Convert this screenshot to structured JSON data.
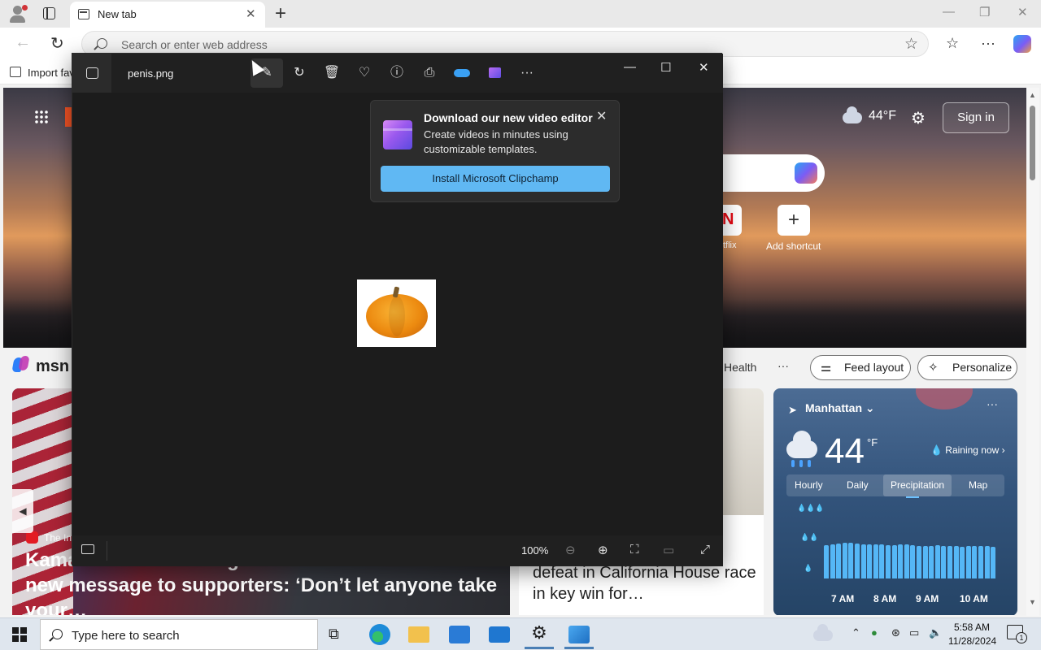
{
  "browser": {
    "tab_title": "New tab",
    "address_placeholder": "Search or enter web address",
    "favorites_import": "Import fav"
  },
  "msn": {
    "weather_temp": "44°F",
    "signin": "Sign in",
    "shortcuts": {
      "netflix_label": "tflix",
      "add_shortcut": "Add shortcut"
    },
    "logo_text": "msn",
    "nav_health": "Health",
    "nav_more": "···",
    "feed_layout": "Feed layout",
    "personalize": "Personalize",
    "main_story": {
      "source": "The In",
      "headline": "Kamala Harris reemerges after election loss with new message to supporters: ‘Don’t let anyone take your…"
    },
    "mid_story": {
      "headline": "defeat in California House race in key win for…"
    },
    "weather_card": {
      "location": "Manhattan",
      "temp": "44",
      "unit": "°F",
      "status": "Raining now",
      "tabs": [
        "Hourly",
        "Daily",
        "Precipitation",
        "Map"
      ],
      "selected_tab": "Precipitation",
      "times": [
        "7 AM",
        "8 AM",
        "9 AM",
        "10 AM"
      ],
      "precip_bars": [
        0.82,
        0.84,
        0.86,
        0.88,
        0.88,
        0.86,
        0.84,
        0.84,
        0.84,
        0.84,
        0.82,
        0.82,
        0.84,
        0.84,
        0.82,
        0.8,
        0.8,
        0.8,
        0.82,
        0.8,
        0.8,
        0.8,
        0.78,
        0.8,
        0.8,
        0.8,
        0.8,
        0.78
      ]
    }
  },
  "viewer": {
    "filename": "penis.png",
    "zoom": "100%",
    "popup": {
      "title": "Download our new video editor",
      "body": "Create videos in minutes using customizable templates.",
      "button": "Install Microsoft Clipchamp"
    }
  },
  "taskbar": {
    "search_placeholder": "Type here to search",
    "time": "5:58 AM",
    "date": "11/28/2024",
    "notifications": "1"
  },
  "colors": {
    "accent_blue": "#60b8f3",
    "viewer_bg": "#1c1c1c",
    "precip_bar": "#55b7f6"
  }
}
